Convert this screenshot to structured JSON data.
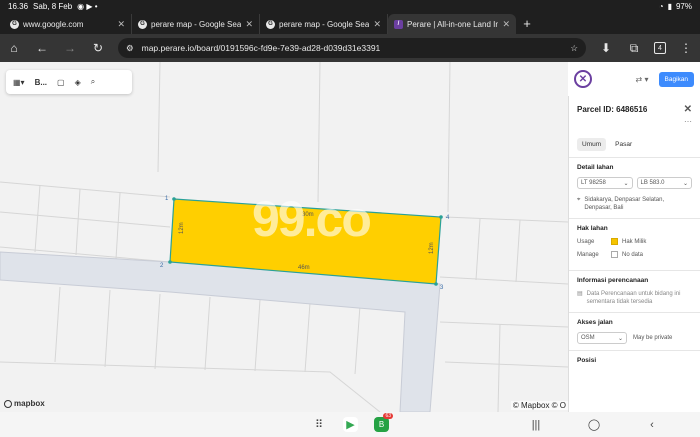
{
  "status_bar": {
    "time": "16.36",
    "date": "Sab, 8 Feb",
    "battery": "97%"
  },
  "tabs": [
    {
      "title": "www.google.com",
      "active": false
    },
    {
      "title": "perare map - Google Search",
      "active": false
    },
    {
      "title": "perare map - Google Search",
      "active": false
    },
    {
      "title": "Perare | All-in-one Land Info",
      "active": true
    }
  ],
  "toolbar": {
    "url": "map.perare.io/board/0191596c-fd9e-7e39-ad28-d039d31e3391",
    "tab_count": "4"
  },
  "map": {
    "basemap_label": "B...",
    "watermark": "99.co",
    "vertex_labels": [
      "1",
      "2",
      "3",
      "4"
    ],
    "edge_labels": {
      "top": "30m",
      "left": "12m",
      "bottom": "46m",
      "right": "12m"
    },
    "mapbox_logo": "mapbox",
    "attribution": "© Mapbox © O"
  },
  "panel": {
    "share_button": "Bagikan",
    "parcel_title": "Parcel ID: 6486516",
    "tabs": [
      "Umum",
      "Pasar"
    ],
    "land_detail": {
      "heading": "Detail lahan",
      "lt": "LT  98258",
      "lb": "LB  583.0",
      "address": "Sidakarya, Denpasar Selatan, Denpasar, Bali"
    },
    "land_rights": {
      "heading": "Hak lahan",
      "usage_label": "Usage",
      "usage_value": "Hak Milik",
      "manage_label": "Manage",
      "manage_value": "No data",
      "usage_color": "#f5c400"
    },
    "planning": {
      "heading": "Informasi perencanaan",
      "text": "Data Perencanaan untuk bidang ini sementara tidak tersedia"
    },
    "road_access": {
      "heading": "Akses jalan",
      "source": "OSM",
      "note": "May be private"
    },
    "position": {
      "heading": "Posisi"
    }
  },
  "android_nav": {
    "notification_badge": "63"
  }
}
